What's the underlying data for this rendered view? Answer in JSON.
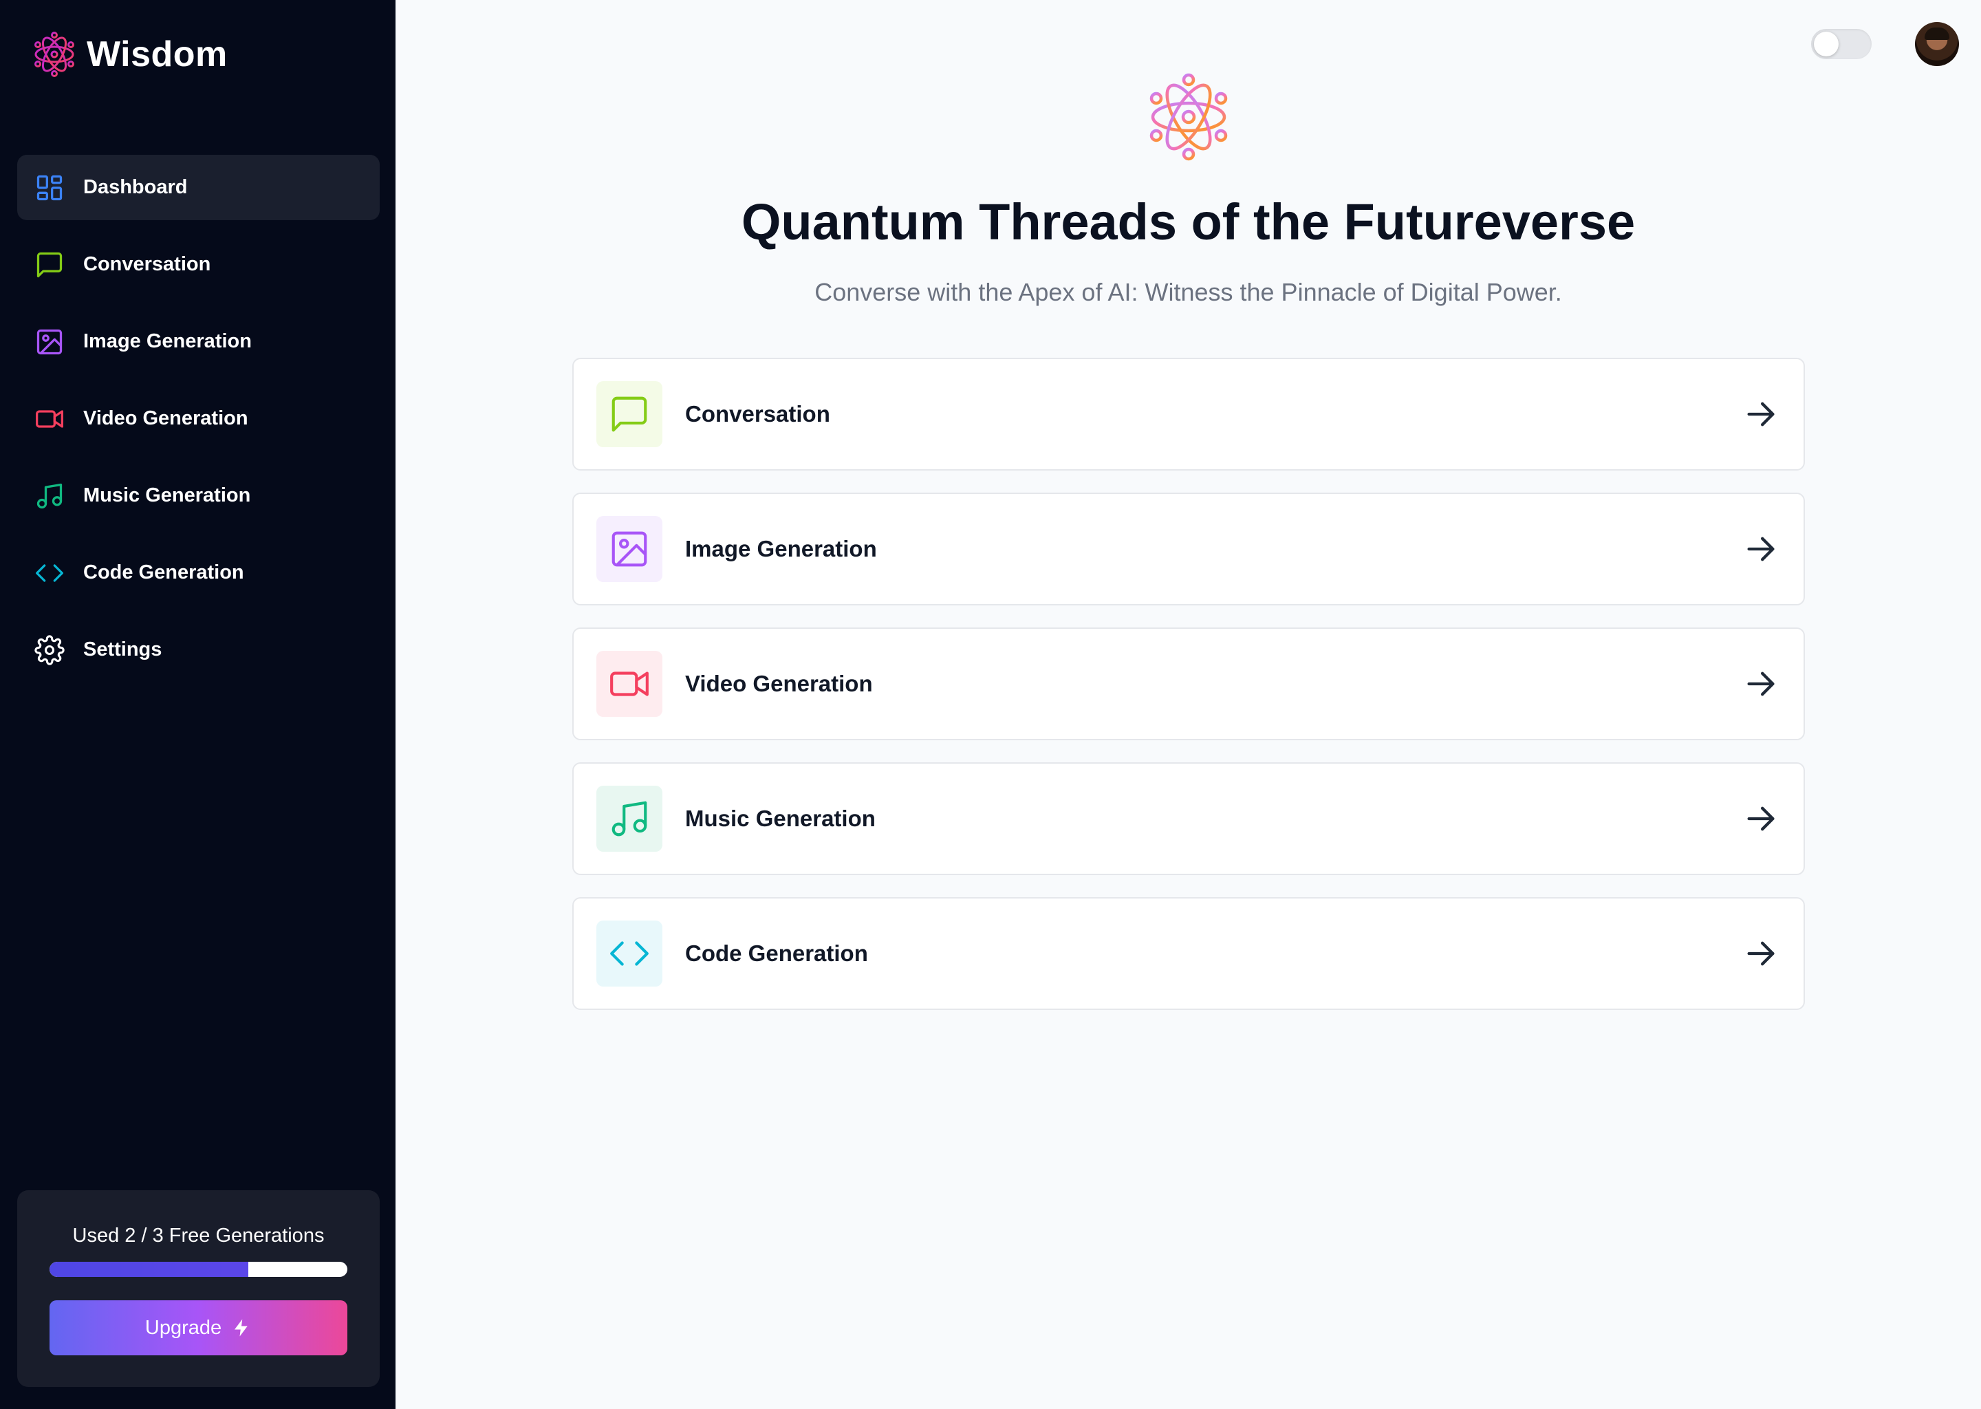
{
  "brand": {
    "name": "Wisdom"
  },
  "sidebar": {
    "items": [
      {
        "label": "Dashboard",
        "icon": "dashboard-icon",
        "color": "#3b82f6",
        "active": true
      },
      {
        "label": "Conversation",
        "icon": "message-icon",
        "color": "#84cc16"
      },
      {
        "label": "Image Generation",
        "icon": "image-icon",
        "color": "#a855f7"
      },
      {
        "label": "Video Generation",
        "icon": "video-icon",
        "color": "#f43f5e"
      },
      {
        "label": "Music Generation",
        "icon": "music-icon",
        "color": "#10b981"
      },
      {
        "label": "Code Generation",
        "icon": "code-icon",
        "color": "#06b6d4"
      },
      {
        "label": "Settings",
        "icon": "gear-icon",
        "color": "#ffffff"
      }
    ],
    "usage": {
      "text": "Used 2 / 3 Free Generations",
      "used": 2,
      "limit": 3,
      "upgrade_label": "Upgrade"
    }
  },
  "main": {
    "title": "Quantum Threads of the Futureverse",
    "subtitle": "Converse with the Apex of AI: Witness the Pinnacle of Digital Power.",
    "cards": [
      {
        "label": "Conversation",
        "icon": "message-icon",
        "color": "#84cc16",
        "bg": "#f4fbe7"
      },
      {
        "label": "Image Generation",
        "icon": "image-icon",
        "color": "#a855f7",
        "bg": "#f6effe"
      },
      {
        "label": "Video Generation",
        "icon": "video-icon",
        "color": "#f43f5e",
        "bg": "#feecef"
      },
      {
        "label": "Music Generation",
        "icon": "music-icon",
        "color": "#10b981",
        "bg": "#e8f7f1"
      },
      {
        "label": "Code Generation",
        "icon": "code-icon",
        "color": "#06b6d4",
        "bg": "#e8f8fb"
      }
    ]
  },
  "colors": {
    "sidebar_bg": "#050a1a",
    "accent": "#6366f1",
    "upgrade_gradient_end": "#ec4899"
  }
}
